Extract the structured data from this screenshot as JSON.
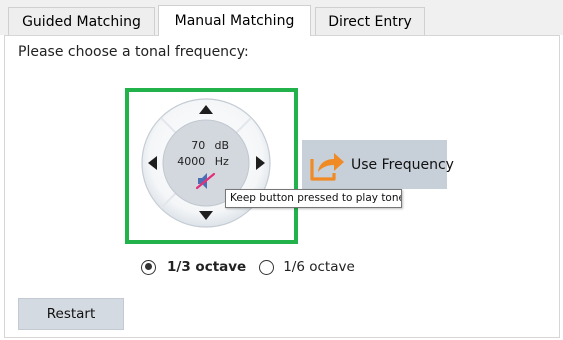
{
  "tabs": [
    {
      "label": "Guided Matching",
      "active": false
    },
    {
      "label": "Manual Matching",
      "active": true
    },
    {
      "label": "Direct Entry",
      "active": false
    }
  ],
  "instruction": "Please choose a tonal frequency:",
  "dial": {
    "level_value": "70",
    "level_unit": "dB",
    "frequency_value": "4000",
    "frequency_unit": "Hz",
    "mute_icon": "speaker-muted-icon",
    "arrows": [
      "up-arrow-icon",
      "down-arrow-icon",
      "left-arrow-icon",
      "right-arrow-icon"
    ]
  },
  "tooltip": "Keep button pressed to play tone",
  "use_frequency": {
    "label": "Use Frequency",
    "icon": "share-arrow-icon"
  },
  "octave_options": [
    {
      "label": "1/3 octave",
      "selected": true
    },
    {
      "label": "1/6 octave",
      "selected": false
    }
  ],
  "restart_label": "Restart",
  "colors": {
    "highlight_border": "#22b24c",
    "mute_accent": "#e2307a",
    "icon_orange": "#f08a24",
    "button_bg": "#c7cfd8"
  }
}
